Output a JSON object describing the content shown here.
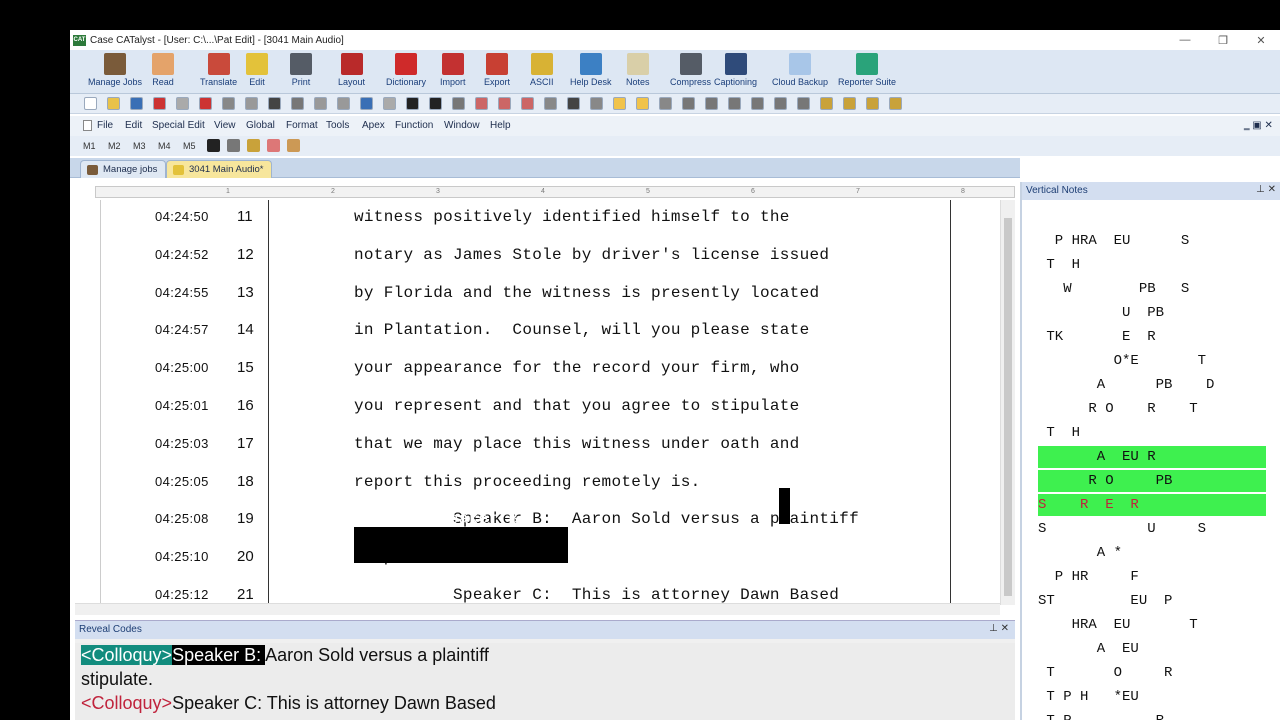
{
  "window": {
    "title": "Case CATalyst - [User: C:\\...\\Pat Edit] - [3041 Main Audio]",
    "app_icon_text": "CAT",
    "minimize": "—",
    "restore": "❐",
    "close": "✕"
  },
  "ribbon": [
    {
      "label": "Manage Jobs",
      "color": "#7a5b3a"
    },
    {
      "label": "Read",
      "color": "#e4a36a"
    },
    {
      "label": "Translate",
      "color": "#c94a3b"
    },
    {
      "label": "Edit",
      "color": "#e3c23a"
    },
    {
      "label": "Print",
      "color": "#555c66"
    },
    {
      "label": "Layout",
      "color": "#b92a2a"
    },
    {
      "label": "Dictionary",
      "color": "#cf2a2a"
    },
    {
      "label": "Import",
      "color": "#c33131"
    },
    {
      "label": "Export",
      "color": "#c84033"
    },
    {
      "label": "ASCII",
      "color": "#d8b234"
    },
    {
      "label": "Help Desk",
      "color": "#3c80c4"
    },
    {
      "label": "Notes",
      "color": "#d9cfa8"
    },
    {
      "label": "Compress",
      "color": "#555c66"
    },
    {
      "label": "Captioning",
      "color": "#2f4b7a"
    },
    {
      "label": "Cloud Backup",
      "color": "#a8c6e8"
    },
    {
      "label": "Reporter Suite",
      "color": "#2aa37a"
    }
  ],
  "menu": [
    "File",
    "Edit",
    "Special Edit",
    "View",
    "Global",
    "Format",
    "Tools",
    "Apex",
    "Function",
    "Window",
    "Help"
  ],
  "macros": [
    "M1",
    "M2",
    "M3",
    "M4",
    "M5"
  ],
  "tabs": {
    "manage": "Manage jobs",
    "active": "3041 Main Audio*"
  },
  "ruler_numbers": [
    "1",
    "2",
    "3",
    "4",
    "5",
    "6",
    "7",
    "8"
  ],
  "transcript": [
    {
      "time": "04:24:50",
      "num": "11",
      "text": "witness positively identified himself to the"
    },
    {
      "time": "04:24:52",
      "num": "12",
      "text": "notary as James Stole by driver's license issued"
    },
    {
      "time": "04:24:55",
      "num": "13",
      "text": "by Florida and the witness is presently located"
    },
    {
      "time": "04:24:57",
      "num": "14",
      "text": "in Plantation.  Counsel, will you please state"
    },
    {
      "time": "04:25:00",
      "num": "15",
      "text": "your appearance for the record your firm, who"
    },
    {
      "time": "04:25:01",
      "num": "16",
      "text": "you represent and that you agree to stipulate"
    },
    {
      "time": "04:25:03",
      "num": "17",
      "text": "that we may place this witness under oath and"
    },
    {
      "time": "04:25:05",
      "num": "18",
      "text": "report this proceeding remotely is."
    },
    {
      "time": "04:25:08",
      "num": "19",
      "text": "          Speaker B:  Aaron Sold versus a plaintiff"
    },
    {
      "time": "04:25:10",
      "num": "20",
      "text": "stipulate."
    },
    {
      "time": "04:25:12",
      "num": "21",
      "text": "          Speaker C:  This is attorney Dawn Based"
    }
  ],
  "reveal_codes": {
    "header": "Reveal Codes",
    "pin": "⊥ ✕",
    "line1_tag": "<Colloquy>",
    "line1_speaker": "Speaker B:  ",
    "line1_text": "Aaron Sold versus a plaintiff",
    "line2_text": "stipulate.",
    "line3_tag": "<Colloquy>",
    "line3_text": "Speaker C:  This is attorney Dawn Based"
  },
  "vertical_notes": {
    "header": "Vertical Notes",
    "controls": "⊥ ✕",
    "rows": [
      {
        "text": "  P HRA  EU      S",
        "hl": false
      },
      {
        "text": " T  H",
        "hl": false
      },
      {
        "text": "   W        PB   S",
        "hl": false
      },
      {
        "text": "          U  PB",
        "hl": false
      },
      {
        "text": " TK       E  R",
        "hl": false
      },
      {
        "text": "         O*E       T",
        "hl": false
      },
      {
        "text": "       A      PB    D",
        "hl": false
      },
      {
        "text": "      R O    R    T",
        "hl": false
      },
      {
        "text": " T  H",
        "hl": false
      },
      {
        "text": "       A  EU R",
        "hl": true
      },
      {
        "text": "      R O     PB",
        "hl": true
      },
      {
        "text": "S    R  E  R",
        "hl": true,
        "red": true
      },
      {
        "text": "S            U     S",
        "hl": false
      },
      {
        "text": "       A *",
        "hl": false
      },
      {
        "text": "  P HR     F",
        "hl": false
      },
      {
        "text": "ST         EU  P",
        "hl": false
      },
      {
        "text": "    HRA  EU       T",
        "hl": false
      },
      {
        "text": "       A  EU",
        "hl": false
      },
      {
        "text": " T       O     R",
        "hl": false
      },
      {
        "text": " T P H   *EU",
        "hl": false
      },
      {
        "text": " T P          R",
        "hl": false
      }
    ]
  }
}
